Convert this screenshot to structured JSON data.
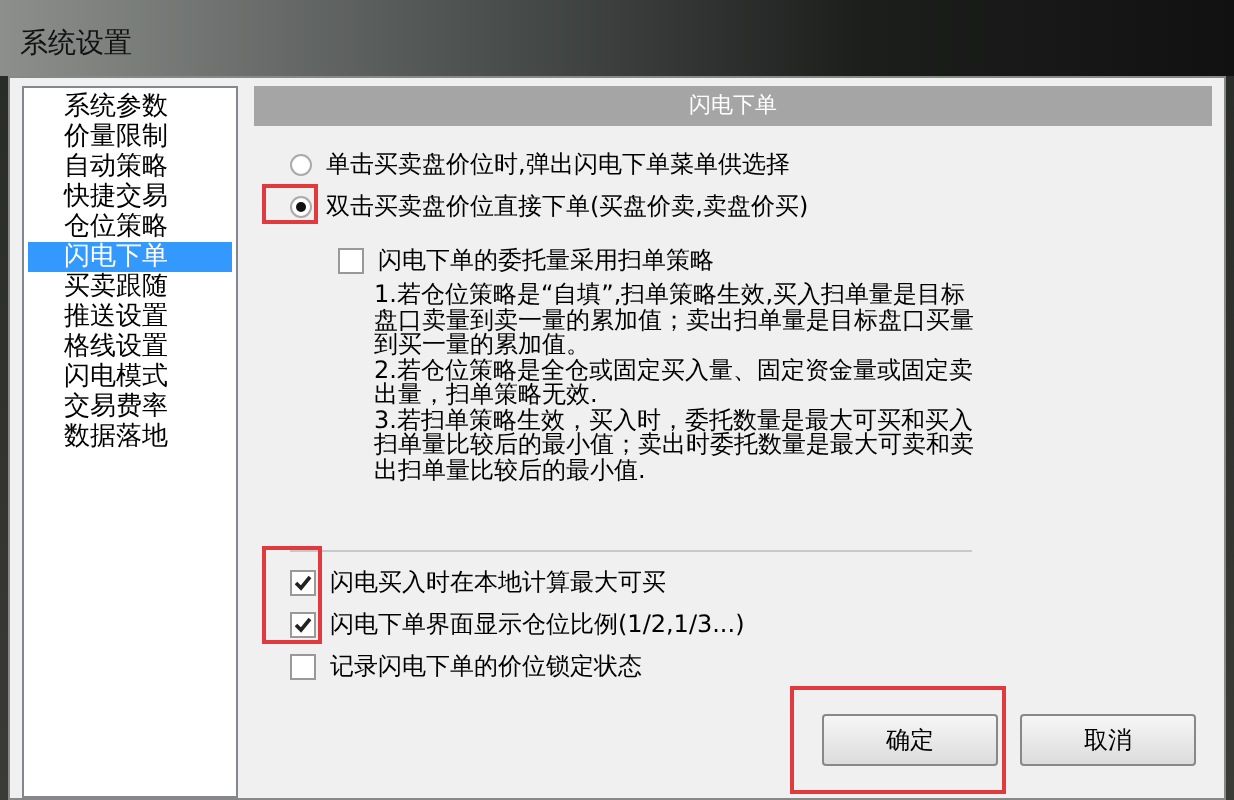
{
  "window": {
    "title": "系统设置"
  },
  "sidebar": {
    "items": [
      {
        "label": "系统参数",
        "selected": false
      },
      {
        "label": "价量限制",
        "selected": false
      },
      {
        "label": "自动策略",
        "selected": false
      },
      {
        "label": "快捷交易",
        "selected": false
      },
      {
        "label": "仓位策略",
        "selected": false
      },
      {
        "label": "闪电下单",
        "selected": true
      },
      {
        "label": "买卖跟随",
        "selected": false
      },
      {
        "label": "推送设置",
        "selected": false
      },
      {
        "label": "格线设置",
        "selected": false
      },
      {
        "label": "闪电模式",
        "selected": false
      },
      {
        "label": "交易费率",
        "selected": false
      },
      {
        "label": "数据落地",
        "selected": false
      }
    ]
  },
  "panel": {
    "title": "闪电下单",
    "radios": [
      {
        "label": "单击买卖盘价位时,弹出闪电下单菜单供选择",
        "selected": false,
        "highlighted": false
      },
      {
        "label": "双击买卖盘价位直接下单(买盘价卖,卖盘价买)",
        "selected": true,
        "highlighted": true
      }
    ],
    "sweep_option": {
      "label": "闪电下单的委托量采用扫单策略",
      "checked": false
    },
    "notes": [
      "1.若仓位策略是“自填”,扫单策略生效,买入扫单量是目标盘口卖量到卖一量的累加值；卖出扫单量是目标盘口买量到买一量的累加值。",
      "2.若仓位策略是全仓或固定买入量、固定资金量或固定卖出量，扫单策略无效.",
      "3.若扫单策略生效，买入时，委托数量是最大可买和买入扫单量比较后的最小值；卖出时委托数量是最大可卖和卖出扫单量比较后的最小值."
    ],
    "checkboxes": [
      {
        "label": "闪电买入时在本地计算最大可买",
        "checked": true,
        "highlighted": true
      },
      {
        "label": "闪电下单界面显示仓位比例(1/2,1/3...)",
        "checked": true,
        "highlighted": true
      },
      {
        "label": "记录闪电下单的价位锁定状态",
        "checked": false,
        "highlighted": false
      }
    ]
  },
  "buttons": [
    {
      "label": "确定",
      "highlighted": true
    },
    {
      "label": "取消",
      "highlighted": false
    }
  ]
}
